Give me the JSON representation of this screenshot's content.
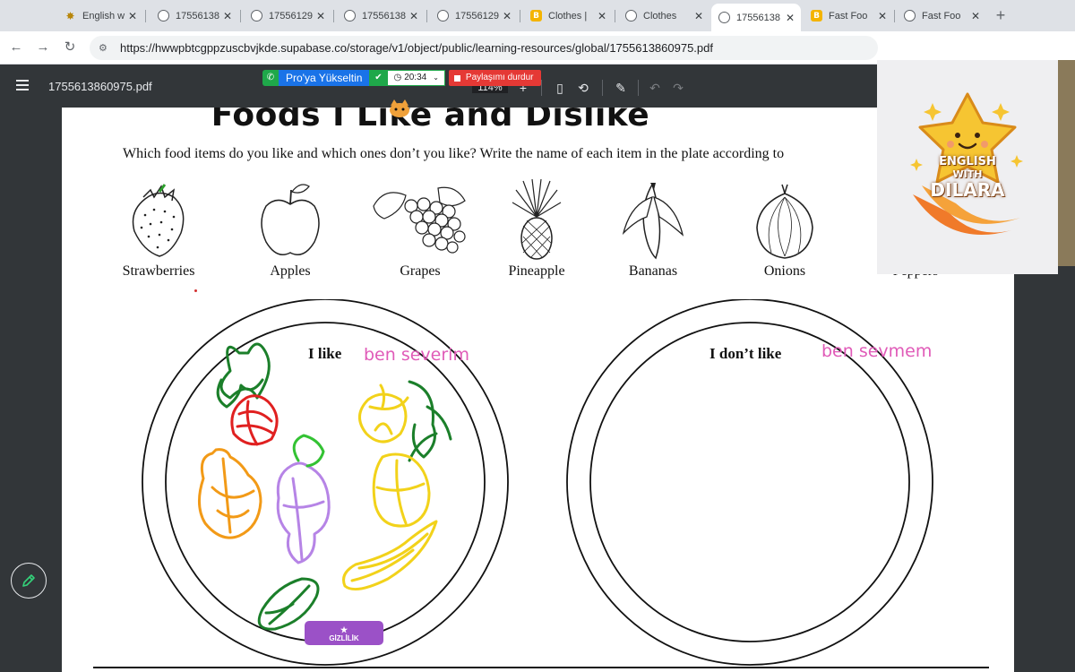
{
  "browser": {
    "tabs": [
      {
        "icon": "star-favicon-icon",
        "title": "English w",
        "active": false
      },
      {
        "icon": "globe-icon",
        "title": "17556138",
        "active": false
      },
      {
        "icon": "globe-icon",
        "title": "17556129",
        "active": false
      },
      {
        "icon": "globe-icon",
        "title": "17556138",
        "active": false
      },
      {
        "icon": "globe-icon",
        "title": "17556129",
        "active": false
      },
      {
        "icon": "brand-b-icon",
        "title": "Clothes |",
        "active": false
      },
      {
        "icon": "globe-icon",
        "title": "Clothes",
        "active": false
      },
      {
        "icon": "globe-icon",
        "title": "17556138",
        "active": true
      },
      {
        "icon": "brand-b-icon",
        "title": "Fast Foo",
        "active": false
      },
      {
        "icon": "globe-icon",
        "title": "Fast Foo",
        "active": false
      }
    ],
    "new_tab": "+",
    "url": "https://hwwpbtcgppzuscbvjkde.supabase.co/storage/v1/object/public/learning-resources/global/1755613860975.pdf"
  },
  "pdf_viewer": {
    "filename": "1755613860975.pdf",
    "zoom": "114%"
  },
  "screen_share": {
    "upgrade_label": "Pro'ya Yükseltin",
    "timer": "20:34",
    "stop_label": "Paylaşımı durdur"
  },
  "document": {
    "title": "Foods I Like and Dislike",
    "instructions": "Which food items do you like and which ones don’t you like? Write the name of each item in the plate according to",
    "foods": [
      "Strawberries",
      "Apples",
      "Grapes",
      "Pineapple",
      "Bananas",
      "Onions",
      "Peppers"
    ],
    "plate_like_label": "I like",
    "plate_like_note": "ben severim",
    "plate_dislike_label": "I don’t like",
    "plate_dislike_note": "ben sevmem"
  },
  "overlays": {
    "privacy_button": "GİZLİLİK",
    "webcam_line1": "ENGLISH",
    "webcam_line2": "WITH",
    "webcam_line3": "DILARA"
  },
  "colors": {
    "chrome_dark": "#323639",
    "share_green": "#1fa84a",
    "share_blue": "#1a73e8",
    "share_red": "#e53935",
    "handwriting_pink": "#e05bb8",
    "privacy_purple": "#9b51c7",
    "star_yellow": "#f6c532"
  }
}
